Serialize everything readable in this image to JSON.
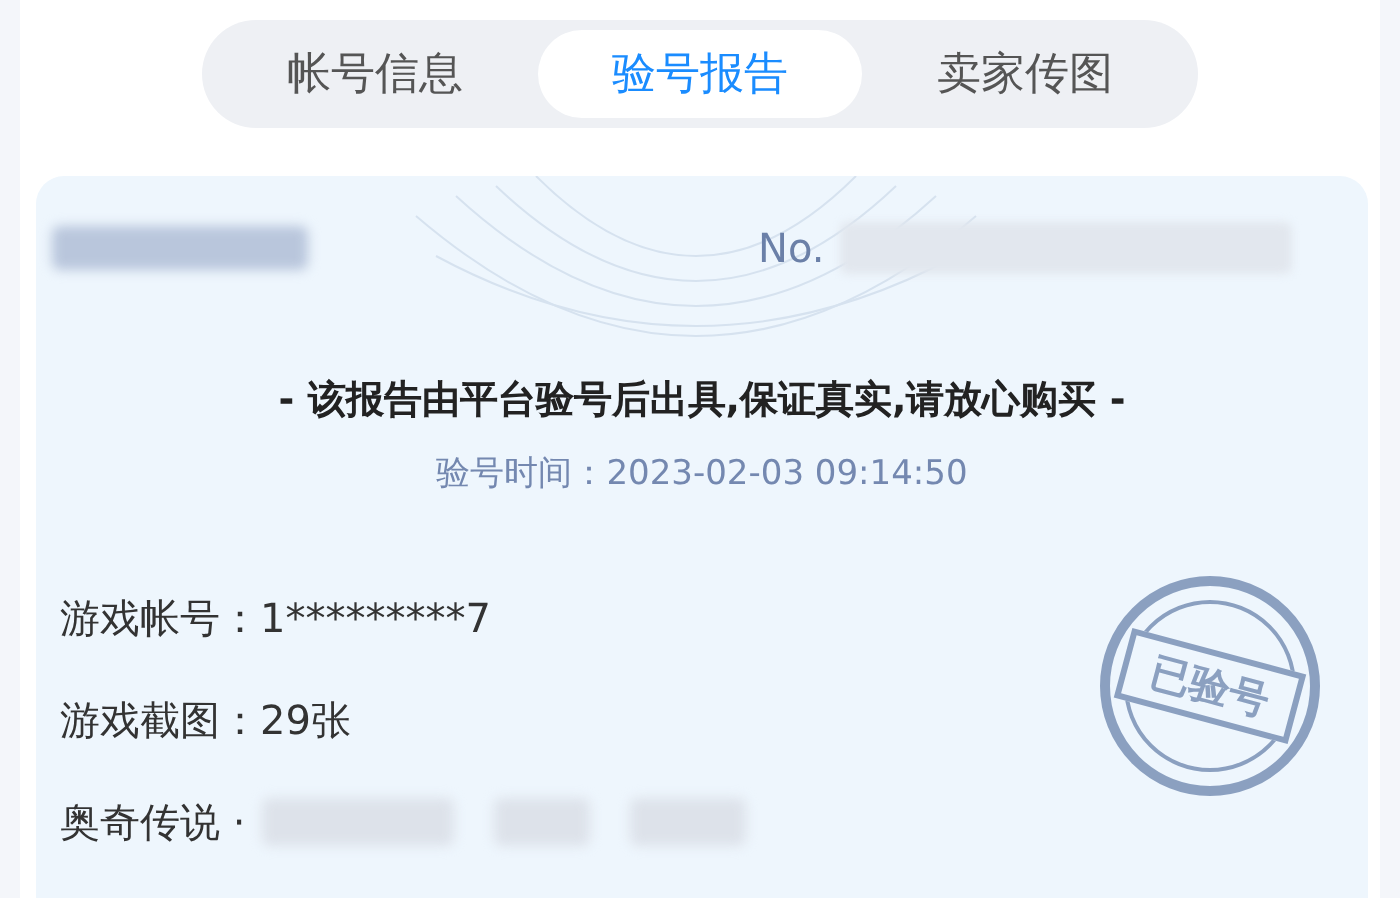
{
  "tabs": [
    {
      "label": "帐号信息",
      "selected": false
    },
    {
      "label": "验号报告",
      "selected": true
    },
    {
      "label": "卖家传图",
      "selected": false
    }
  ],
  "report": {
    "number_prefix": "No.",
    "title": "- 该报告由平台验号后出具,保证真实,请放心购买 -",
    "time": "验号时间：2023-02-03 09:14:50",
    "fields": [
      {
        "label": "游戏帐号：",
        "value": "1*********7"
      },
      {
        "label": "游戏截图：",
        "value": "29张"
      },
      {
        "label": "奥奇传说 ·"
      }
    ],
    "stamp": "已验号"
  }
}
